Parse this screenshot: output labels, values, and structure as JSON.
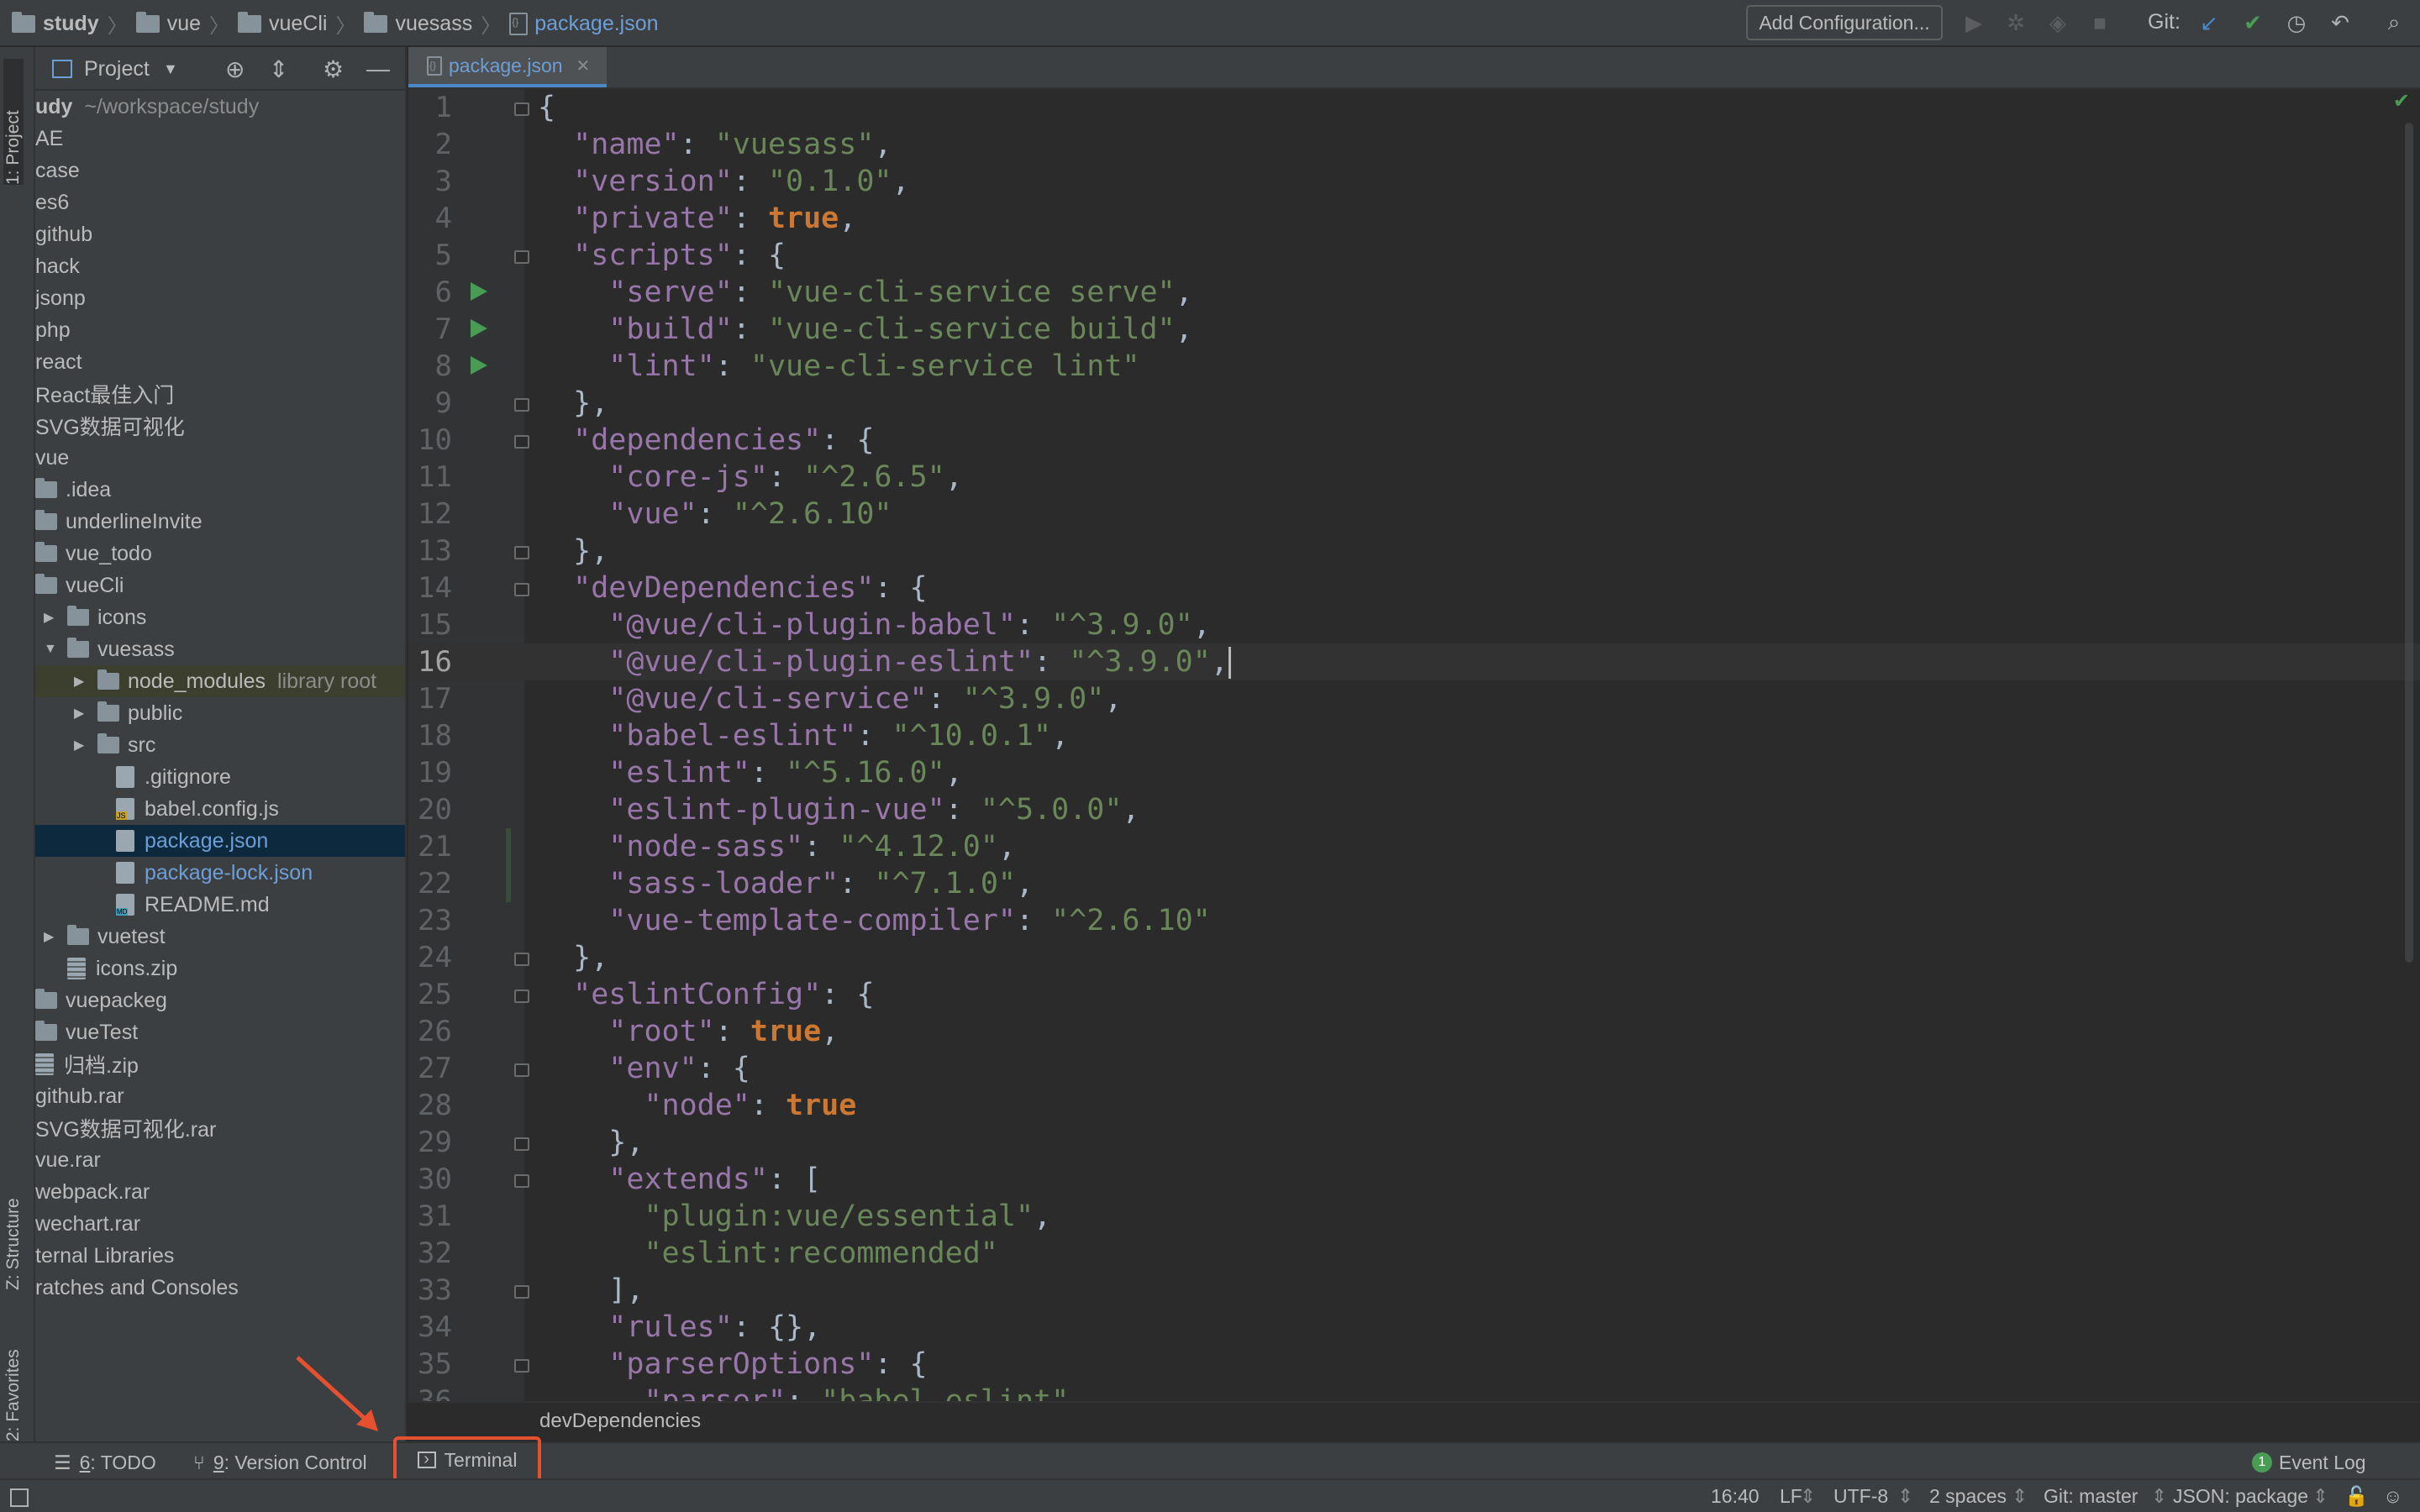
{
  "breadcrumb": {
    "items": [
      "study",
      "vue",
      "vueCli",
      "vuesass"
    ],
    "file": "package.json"
  },
  "toolbar": {
    "add_configuration": "Add Configuration...",
    "git_label": "Git:"
  },
  "left_stripe": {
    "project_tab": "1: Project",
    "structure_tab": "Z: Structure",
    "favorites_tab": "2: Favorites"
  },
  "project_panel": {
    "title": "Project",
    "tree": [
      {
        "label": "udy",
        "extra": "~/workspace/study",
        "indent": 0,
        "icon": "none",
        "bold": true
      },
      {
        "label": "AE",
        "indent": 0,
        "icon": "none"
      },
      {
        "label": "case",
        "indent": 0,
        "icon": "none"
      },
      {
        "label": "es6",
        "indent": 0,
        "icon": "none"
      },
      {
        "label": "github",
        "indent": 0,
        "icon": "none"
      },
      {
        "label": "hack",
        "indent": 0,
        "icon": "none"
      },
      {
        "label": "jsonp",
        "indent": 0,
        "icon": "none"
      },
      {
        "label": "php",
        "indent": 0,
        "icon": "none"
      },
      {
        "label": "react",
        "indent": 0,
        "icon": "none"
      },
      {
        "label": "React最佳入门",
        "indent": 0,
        "icon": "none"
      },
      {
        "label": "SVG数据可视化",
        "indent": 0,
        "icon": "none"
      },
      {
        "label": "vue",
        "indent": 0,
        "icon": "none"
      },
      {
        "label": ".idea",
        "indent": 1,
        "icon": "folder"
      },
      {
        "label": "underlineInvite",
        "indent": 1,
        "icon": "folder"
      },
      {
        "label": "vue_todo",
        "indent": 1,
        "icon": "folder"
      },
      {
        "label": "vueCli",
        "indent": 1,
        "icon": "folder"
      },
      {
        "label": "icons",
        "indent": 2,
        "icon": "folder",
        "arrow": "▶"
      },
      {
        "label": "vuesass",
        "indent": 2,
        "icon": "folder",
        "arrow": "▼"
      },
      {
        "label": "node_modules",
        "extra": "library root",
        "indent": 3,
        "icon": "folder",
        "arrow": "▶",
        "highlight": true
      },
      {
        "label": "public",
        "indent": 3,
        "icon": "folder",
        "arrow": "▶"
      },
      {
        "label": "src",
        "indent": 3,
        "icon": "folder",
        "arrow": "▶"
      },
      {
        "label": ".gitignore",
        "indent": 4,
        "icon": "file"
      },
      {
        "label": "babel.config.js",
        "indent": 4,
        "icon": "js"
      },
      {
        "label": "package.json",
        "indent": 4,
        "icon": "file",
        "selected": true,
        "blue": true
      },
      {
        "label": "package-lock.json",
        "indent": 4,
        "icon": "file",
        "blue": true
      },
      {
        "label": "README.md",
        "indent": 4,
        "icon": "md"
      },
      {
        "label": "vuetest",
        "indent": 2,
        "icon": "folder",
        "arrow": "▶"
      },
      {
        "label": "icons.zip",
        "indent": 2,
        "icon": "zip"
      },
      {
        "label": "vuepackeg",
        "indent": 1,
        "icon": "folder"
      },
      {
        "label": "vueTest",
        "indent": 1,
        "icon": "folder"
      },
      {
        "label": "归档.zip",
        "indent": 0,
        "icon": "zip"
      },
      {
        "label": "github.rar",
        "indent": 0,
        "icon": "none"
      },
      {
        "label": "SVG数据可视化.rar",
        "indent": 0,
        "icon": "none"
      },
      {
        "label": "vue.rar",
        "indent": 0,
        "icon": "none"
      },
      {
        "label": "webpack.rar",
        "indent": 0,
        "icon": "none"
      },
      {
        "label": "wechart.rar",
        "indent": 0,
        "icon": "none"
      },
      {
        "label": "ternal Libraries",
        "indent": 0,
        "icon": "none"
      },
      {
        "label": "ratches and Consoles",
        "indent": 0,
        "icon": "none"
      }
    ]
  },
  "editor": {
    "tab_label": "package.json",
    "current_line": 16,
    "lines": [
      [
        [
          "p",
          "{"
        ]
      ],
      [
        [
          "p",
          "  "
        ],
        [
          "k",
          "\"name\""
        ],
        [
          "p",
          ": "
        ],
        [
          "s",
          "\"vuesass\""
        ],
        [
          "p",
          ","
        ]
      ],
      [
        [
          "p",
          "  "
        ],
        [
          "k",
          "\"version\""
        ],
        [
          "p",
          ": "
        ],
        [
          "s",
          "\"0.1.0\""
        ],
        [
          "p",
          ","
        ]
      ],
      [
        [
          "p",
          "  "
        ],
        [
          "k",
          "\"private\""
        ],
        [
          "p",
          ": "
        ],
        [
          "c",
          "true"
        ],
        [
          "p",
          ","
        ]
      ],
      [
        [
          "p",
          "  "
        ],
        [
          "k",
          "\"scripts\""
        ],
        [
          "p",
          ": {"
        ]
      ],
      [
        [
          "p",
          "    "
        ],
        [
          "k",
          "\"serve\""
        ],
        [
          "p",
          ": "
        ],
        [
          "s",
          "\"vue-cli-service serve\""
        ],
        [
          "p",
          ","
        ]
      ],
      [
        [
          "p",
          "    "
        ],
        [
          "k",
          "\"build\""
        ],
        [
          "p",
          ": "
        ],
        [
          "s",
          "\"vue-cli-service build\""
        ],
        [
          "p",
          ","
        ]
      ],
      [
        [
          "p",
          "    "
        ],
        [
          "k",
          "\"lint\""
        ],
        [
          "p",
          ": "
        ],
        [
          "s",
          "\"vue-cli-service lint\""
        ]
      ],
      [
        [
          "p",
          "  },"
        ]
      ],
      [
        [
          "p",
          "  "
        ],
        [
          "k",
          "\"dependencies\""
        ],
        [
          "p",
          ": {"
        ]
      ],
      [
        [
          "p",
          "    "
        ],
        [
          "k",
          "\"core-js\""
        ],
        [
          "p",
          ": "
        ],
        [
          "s",
          "\"^2.6.5\""
        ],
        [
          "p",
          ","
        ]
      ],
      [
        [
          "p",
          "    "
        ],
        [
          "k",
          "\"vue\""
        ],
        [
          "p",
          ": "
        ],
        [
          "s",
          "\"^2.6.10\""
        ]
      ],
      [
        [
          "p",
          "  },"
        ]
      ],
      [
        [
          "p",
          "  "
        ],
        [
          "k",
          "\"devDependencies\""
        ],
        [
          "p",
          ": {"
        ]
      ],
      [
        [
          "p",
          "    "
        ],
        [
          "k",
          "\"@vue/cli-plugin-babel\""
        ],
        [
          "p",
          ": "
        ],
        [
          "s",
          "\"^3.9.0\""
        ],
        [
          "p",
          ","
        ]
      ],
      [
        [
          "p",
          "    "
        ],
        [
          "k",
          "\"@vue/cli-plugin-eslint\""
        ],
        [
          "p",
          ": "
        ],
        [
          "s",
          "\"^3.9.0\""
        ],
        [
          "p",
          ","
        ]
      ],
      [
        [
          "p",
          "    "
        ],
        [
          "k",
          "\"@vue/cli-service\""
        ],
        [
          "p",
          ": "
        ],
        [
          "s",
          "\"^3.9.0\""
        ],
        [
          "p",
          ","
        ]
      ],
      [
        [
          "p",
          "    "
        ],
        [
          "k",
          "\"babel-eslint\""
        ],
        [
          "p",
          ": "
        ],
        [
          "s",
          "\"^10.0.1\""
        ],
        [
          "p",
          ","
        ]
      ],
      [
        [
          "p",
          "    "
        ],
        [
          "k",
          "\"eslint\""
        ],
        [
          "p",
          ": "
        ],
        [
          "s",
          "\"^5.16.0\""
        ],
        [
          "p",
          ","
        ]
      ],
      [
        [
          "p",
          "    "
        ],
        [
          "k",
          "\"eslint-plugin-vue\""
        ],
        [
          "p",
          ": "
        ],
        [
          "s",
          "\"^5.0.0\""
        ],
        [
          "p",
          ","
        ]
      ],
      [
        [
          "p",
          "    "
        ],
        [
          "k",
          "\"node-sass\""
        ],
        [
          "p",
          ": "
        ],
        [
          "s",
          "\"^4.12.0\""
        ],
        [
          "p",
          ","
        ]
      ],
      [
        [
          "p",
          "    "
        ],
        [
          "k",
          "\"sass-loader\""
        ],
        [
          "p",
          ": "
        ],
        [
          "s",
          "\"^7.1.0\""
        ],
        [
          "p",
          ","
        ]
      ],
      [
        [
          "p",
          "    "
        ],
        [
          "k",
          "\"vue-template-compiler\""
        ],
        [
          "p",
          ": "
        ],
        [
          "s",
          "\"^2.6.10\""
        ]
      ],
      [
        [
          "p",
          "  },"
        ]
      ],
      [
        [
          "p",
          "  "
        ],
        [
          "k",
          "\"eslintConfig\""
        ],
        [
          "p",
          ": {"
        ]
      ],
      [
        [
          "p",
          "    "
        ],
        [
          "k",
          "\"root\""
        ],
        [
          "p",
          ": "
        ],
        [
          "c",
          "true"
        ],
        [
          "p",
          ","
        ]
      ],
      [
        [
          "p",
          "    "
        ],
        [
          "k",
          "\"env\""
        ],
        [
          "p",
          ": {"
        ]
      ],
      [
        [
          "p",
          "      "
        ],
        [
          "k",
          "\"node\""
        ],
        [
          "p",
          ": "
        ],
        [
          "c",
          "true"
        ]
      ],
      [
        [
          "p",
          "    },"
        ]
      ],
      [
        [
          "p",
          "    "
        ],
        [
          "k",
          "\"extends\""
        ],
        [
          "p",
          ": ["
        ]
      ],
      [
        [
          "p",
          "      "
        ],
        [
          "s",
          "\"plugin:vue/essential\""
        ],
        [
          "p",
          ","
        ]
      ],
      [
        [
          "p",
          "      "
        ],
        [
          "s",
          "\"eslint:recommended\""
        ]
      ],
      [
        [
          "p",
          "    ],"
        ]
      ],
      [
        [
          "p",
          "    "
        ],
        [
          "k",
          "\"rules\""
        ],
        [
          "p",
          ": {},"
        ]
      ],
      [
        [
          "p",
          "    "
        ],
        [
          "k",
          "\"parserOptions\""
        ],
        [
          "p",
          ": {"
        ]
      ],
      [
        [
          "p",
          "      "
        ],
        [
          "k",
          "\"parser\""
        ],
        [
          "p",
          ": "
        ],
        [
          "s",
          "\"babel-eslint\""
        ]
      ]
    ],
    "run_markers": [
      6,
      7,
      8
    ],
    "fold_markers": [
      1,
      5,
      9,
      10,
      13,
      14,
      24,
      25,
      27,
      29,
      30,
      33,
      35
    ],
    "changed_lines": [
      21,
      22
    ],
    "context_breadcrumb": "devDependencies"
  },
  "tool_windows": {
    "todo_num": "6",
    "todo_label": ": TODO",
    "vcs_num": "9",
    "vcs_label": ": Version Control",
    "terminal_label": "Terminal",
    "event_log_count": "1",
    "event_log_label": "Event Log"
  },
  "status": {
    "position": "16:40",
    "line_separator": "LF",
    "encoding": "UTF-8",
    "indent": "2 spaces",
    "git_branch": "Git: master",
    "schema": "JSON: package"
  },
  "colors": {
    "key": "#9876aa",
    "string": "#6a8759",
    "keyword": "#cc7832",
    "punct": "#a9b7c6",
    "annotation": "#e5502e"
  }
}
